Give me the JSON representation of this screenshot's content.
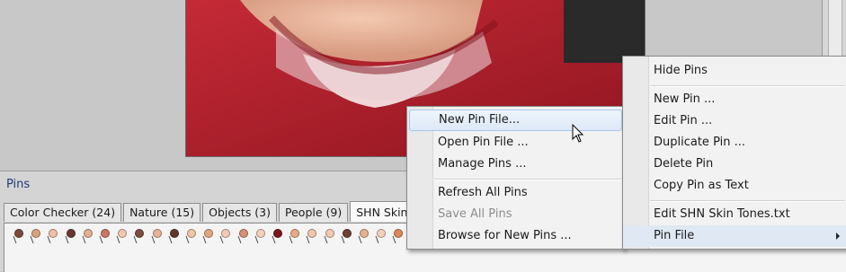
{
  "pins_panel": {
    "title": "Pins",
    "tabs": [
      {
        "label": "Color Checker (24)"
      },
      {
        "label": "Nature (15)"
      },
      {
        "label": "Objects (3)"
      },
      {
        "label": "People (9)"
      },
      {
        "label": "SHN Skin Tones",
        "active": true
      }
    ],
    "pin_colors": [
      "#7a4a38",
      "#d9a27c",
      "#f0c1a8",
      "#6a3a2e",
      "#e3b094",
      "#c9785f",
      "#f2c7ae",
      "#7b4d3f",
      "#e7b594",
      "#5e382c",
      "#f0c6a8",
      "#e2a67e",
      "#f3cab2",
      "#d49272",
      "#f4d1bb",
      "#7b1620",
      "#e9aa86",
      "#f0c6ab",
      "#f3c9b2",
      "#6e4233",
      "#e7b192",
      "#f6d0ba",
      "#e08859"
    ]
  },
  "context_menu": {
    "items": {
      "hide_pins": "Hide Pins",
      "new_pin": "New Pin ...",
      "edit_pin": "Edit Pin ...",
      "duplicate_pin": "Duplicate Pin ...",
      "delete_pin": "Delete Pin",
      "copy_pin_as_text": "Copy Pin as Text",
      "edit_file": "Edit SHN Skin Tones.txt",
      "pin_file": "Pin File"
    }
  },
  "pin_file_submenu": {
    "items": {
      "new_pin_file": "New Pin File...",
      "open_pin_file": "Open Pin File ...",
      "manage_pins": "Manage Pins ...",
      "refresh_all_pins": "Refresh All Pins",
      "save_all_pins": "Save All Pins",
      "browse_for_new_pins": "Browse for New Pins ..."
    }
  },
  "colors": {
    "accent_title": "#1f3a78",
    "menu_highlight_border": "#a9c6e8",
    "photo_shirt_red": "#aa1e2a"
  }
}
